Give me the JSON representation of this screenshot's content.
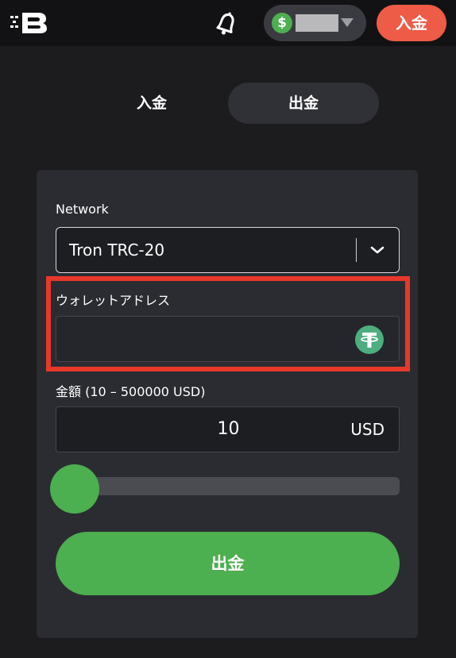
{
  "header": {
    "logo_icon": "bitcasino-b-logo-icon",
    "bell_icon": "bell-icon",
    "balance": {
      "currency_icon": "dollar-icon",
      "caret_icon": "caret-down-icon"
    },
    "deposit_button_label": "入金"
  },
  "tabs": [
    {
      "label": "入金",
      "active": false
    },
    {
      "label": "出金",
      "active": true
    }
  ],
  "form": {
    "network": {
      "label": "Network",
      "value": "Tron TRC-20",
      "icon": "chevron-down-icon"
    },
    "wallet": {
      "label": "ウォレットアドレス",
      "value": "",
      "placeholder": "",
      "icon": "tether-icon",
      "highlight_color": "#e8382a"
    },
    "amount": {
      "label": "金額 (10 – 500000 USD)",
      "value": "10",
      "unit": "USD"
    },
    "slider": {
      "min": 10,
      "max": 500000,
      "value": 10
    },
    "submit_label": "出金"
  },
  "colors": {
    "accent_green": "#4caf50",
    "deposit_red": "#ee5b47",
    "background": "#1c1c1f",
    "card": "#2b2c31"
  }
}
